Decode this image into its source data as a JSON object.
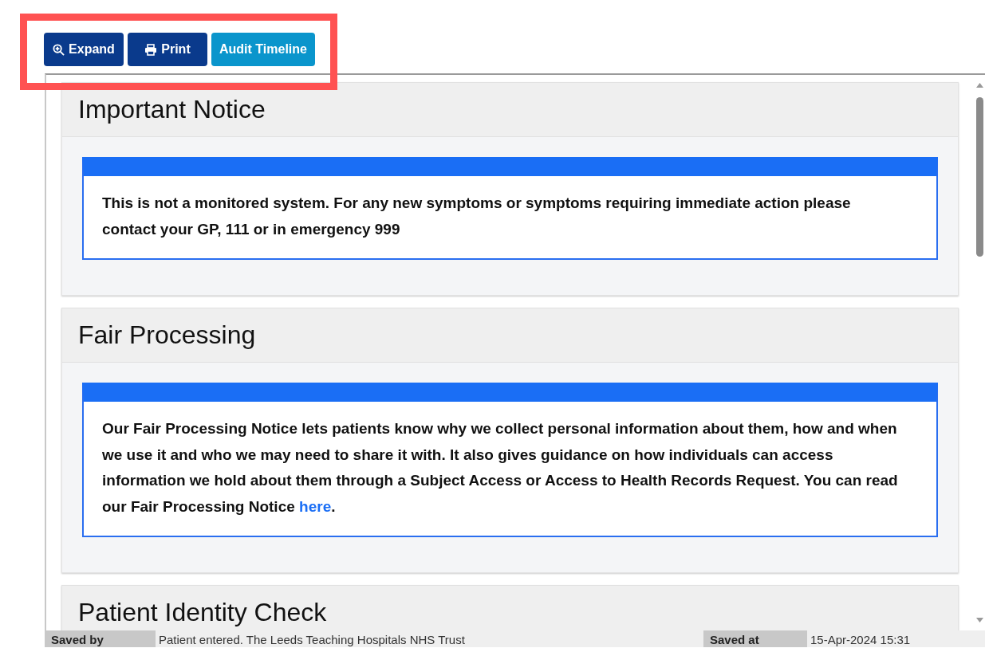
{
  "toolbar": {
    "buttons": [
      {
        "kind": "expand",
        "label": "Expand"
      },
      {
        "kind": "print",
        "label": "Print"
      },
      {
        "kind": "timeline",
        "label": "Audit Timeline"
      }
    ]
  },
  "sections": [
    {
      "title": "Important Notice",
      "notice": "This is not a monitored system. For any new symptoms or symptoms requiring immediate action please contact your GP, 111 or in emergency 999"
    },
    {
      "title": "Fair Processing",
      "notice": "Our Fair Processing Notice lets patients know why we collect personal information about them, how and when we use it and who we may need to share it with. It also gives guidance on how individuals can access information we hold about them through a Subject Access or Access to Health Records Request. You can read our Fair Processing Notice",
      "link": "here",
      "after_link": "."
    },
    {
      "title": "Patient Identity Check"
    }
  ],
  "footer": {
    "saved_by_label": "Saved by",
    "saved_by": "Patient entered. The Leeds Teaching Hospitals NHS Trust",
    "saved_at_label": "Saved at",
    "saved_at": "15-Apr-2024 15:31"
  }
}
